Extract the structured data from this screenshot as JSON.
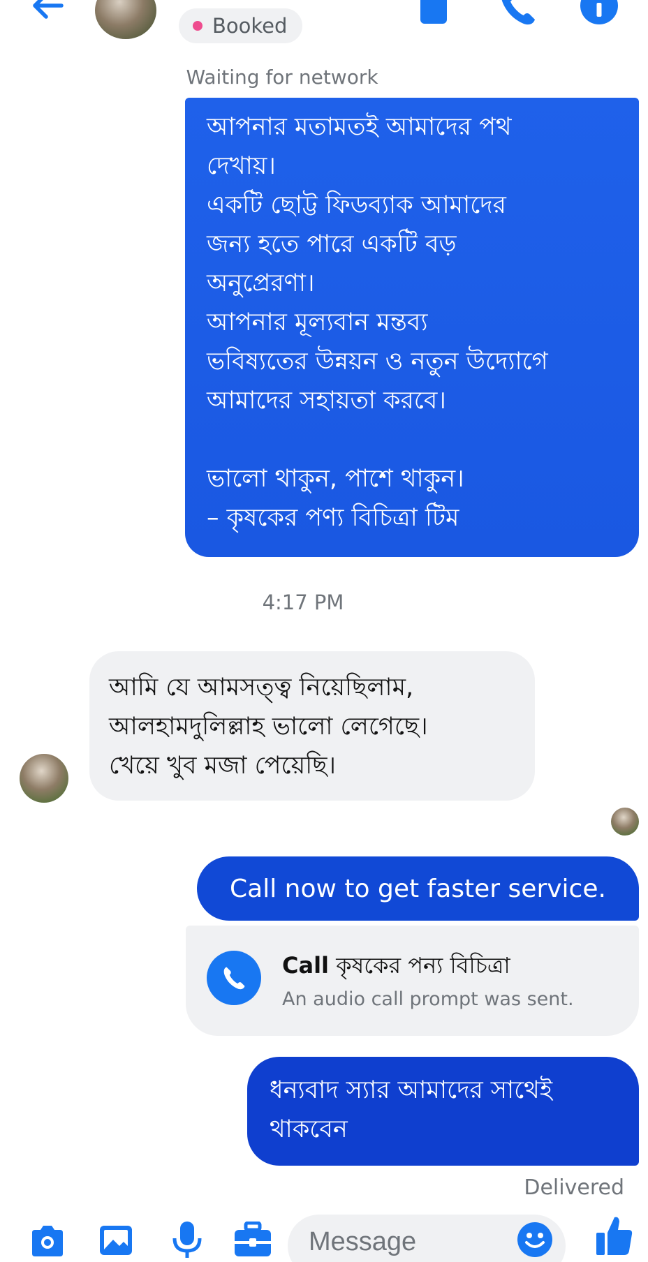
{
  "header": {
    "status_label": "Booked",
    "status_color": "#ee4c8e",
    "accent_color": "#1877f2",
    "icons": [
      "back-arrow-icon",
      "calendar-icon",
      "phone-icon",
      "info-icon"
    ]
  },
  "network_status": "Waiting for network",
  "messages": {
    "feedback_request": "আপনার মতামতই আমাদের পথ\nদেখায়।\nএকটি ছোট্ট ফিডব্যাক আমাদের\nজন্য হতে পারে একটি বড়\nঅনুপ্রেরণা।\nআপনার মূল্যবান মন্তব্য\nভবিষ্যতের উন্নয়ন ও নতুন উদ্যোগে\nআমাদের সহায়তা করবে।\n\nভালো থাকুন, পাশে থাকুন।\n– কৃষকের পণ্য বিচিত্রা টিম",
    "timestamp": "4:17 PM",
    "incoming_reply": "আমি যে আমসত্ত্ব নিয়েছিলাম,\nআলহামদুলিল্লাহ  ভালো লেগেছে।\nখেয়ে খুব মজা পেয়েছি।",
    "call_now": "Call now to get faster service.",
    "call_card": {
      "prefix": "Call",
      "name": "কৃষকের পন্য বিচিত্রা",
      "subtitle": "An audio call prompt was sent."
    },
    "thanks_reply": "ধন্যবাদ স্যার আমাদের সাথেই\nথাকবেন",
    "delivery_status": "Delivered"
  },
  "composer": {
    "placeholder": "Message",
    "icons": [
      "camera-icon",
      "image-icon",
      "microphone-icon",
      "briefcase-icon",
      "emoji-icon",
      "thumbs-up-icon"
    ]
  },
  "colors": {
    "outgoing_bubble": "#1f61ea",
    "outgoing_bubble_dark": "#0f3fcf",
    "incoming_bubble": "#f0f1f3"
  }
}
